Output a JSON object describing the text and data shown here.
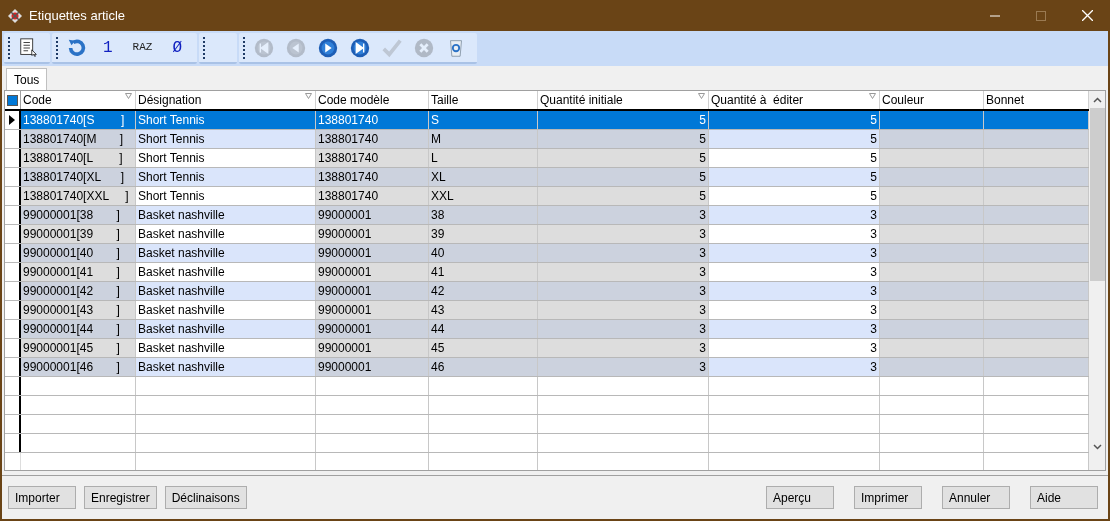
{
  "window": {
    "title": "Etiquettes article"
  },
  "toolbar": [
    {
      "kind": "list-icon",
      "disabled": false
    },
    {
      "kind": "sep"
    },
    {
      "kind": "refresh-icon",
      "disabled": false
    },
    {
      "kind": "text",
      "label": "1",
      "disabled": false
    },
    {
      "kind": "text",
      "label": "RAZ",
      "disabled": false
    },
    {
      "kind": "text",
      "label": "Ø",
      "disabled": false
    },
    {
      "kind": "sep"
    },
    {
      "kind": "sep"
    },
    {
      "kind": "first-icon",
      "disabled": true
    },
    {
      "kind": "prev-icon",
      "disabled": true
    },
    {
      "kind": "next-icon",
      "disabled": false
    },
    {
      "kind": "last-icon",
      "disabled": false
    },
    {
      "kind": "check-icon",
      "disabled": true
    },
    {
      "kind": "cancel-icon",
      "disabled": true
    },
    {
      "kind": "trash-icon",
      "disabled": false
    }
  ],
  "tabs": [
    {
      "label": "Tous",
      "selected": true
    }
  ],
  "table": {
    "columns": [
      {
        "label": "Code",
        "kind": "text",
        "filter": true,
        "editable": false
      },
      {
        "label": "Désignation",
        "kind": "text",
        "filter": true,
        "editable": true
      },
      {
        "label": "Code modèle",
        "kind": "text",
        "filter": false,
        "editable": false
      },
      {
        "label": "Taille",
        "kind": "text",
        "filter": false,
        "editable": false
      },
      {
        "label": "Quantité initiale",
        "kind": "number",
        "filter": true,
        "editable": false
      },
      {
        "label": "Quantité à  éditer",
        "kind": "number",
        "filter": true,
        "editable": true
      },
      {
        "label": "Couleur",
        "kind": "text",
        "filter": false,
        "editable": false
      },
      {
        "label": "Bonnet",
        "kind": "text",
        "filter": false,
        "editable": false
      }
    ],
    "select_all_checked": true,
    "rows": [
      {
        "selected": true,
        "cells": [
          "138801740[S        ]",
          "Short Tennis",
          "138801740",
          "S",
          "5",
          "5",
          "",
          ""
        ]
      },
      {
        "selected": false,
        "cells": [
          "138801740[M       ]",
          "Short Tennis",
          "138801740",
          "M",
          "5",
          "5",
          "",
          ""
        ]
      },
      {
        "selected": false,
        "cells": [
          "138801740[L        ]",
          "Short Tennis",
          "138801740",
          "L",
          "5",
          "5",
          "",
          ""
        ]
      },
      {
        "selected": false,
        "cells": [
          "138801740[XL      ]",
          "Short Tennis",
          "138801740",
          "XL",
          "5",
          "5",
          "",
          ""
        ]
      },
      {
        "selected": false,
        "cells": [
          "138801740[XXL     ]",
          "Short Tennis",
          "138801740",
          "XXL",
          "5",
          "5",
          "",
          ""
        ]
      },
      {
        "selected": false,
        "cells": [
          "99000001[38       ]",
          "Basket nashville",
          "99000001",
          "38",
          "3",
          "3",
          "",
          ""
        ]
      },
      {
        "selected": false,
        "cells": [
          "99000001[39       ]",
          "Basket nashville",
          "99000001",
          "39",
          "3",
          "3",
          "",
          ""
        ]
      },
      {
        "selected": false,
        "cells": [
          "99000001[40       ]",
          "Basket nashville",
          "99000001",
          "40",
          "3",
          "3",
          "",
          ""
        ]
      },
      {
        "selected": false,
        "cells": [
          "99000001[41       ]",
          "Basket nashville",
          "99000001",
          "41",
          "3",
          "3",
          "",
          ""
        ]
      },
      {
        "selected": false,
        "cells": [
          "99000001[42       ]",
          "Basket nashville",
          "99000001",
          "42",
          "3",
          "3",
          "",
          ""
        ]
      },
      {
        "selected": false,
        "cells": [
          "99000001[43       ]",
          "Basket nashville",
          "99000001",
          "43",
          "3",
          "3",
          "",
          ""
        ]
      },
      {
        "selected": false,
        "cells": [
          "99000001[44       ]",
          "Basket nashville",
          "99000001",
          "44",
          "3",
          "3",
          "",
          ""
        ]
      },
      {
        "selected": false,
        "cells": [
          "99000001[45       ]",
          "Basket nashville",
          "99000001",
          "45",
          "3",
          "3",
          "",
          ""
        ]
      },
      {
        "selected": false,
        "cells": [
          "99000001[46       ]",
          "Basket nashville",
          "99000001",
          "46",
          "3",
          "3",
          "",
          ""
        ]
      }
    ]
  },
  "buttons_left": [
    "Importer",
    "Enregistrer",
    "Déclinaisons"
  ],
  "buttons_right": [
    "Aperçu",
    "Imprimer",
    "Annuler",
    "Aide"
  ]
}
